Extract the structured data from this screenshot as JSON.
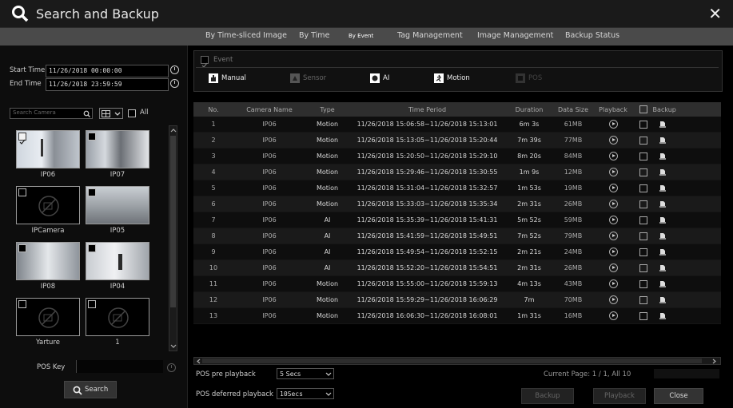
{
  "window": {
    "title": "Search and Backup",
    "close_label": "✕"
  },
  "tabs": [
    {
      "label": "By Time-sliced Image"
    },
    {
      "label": "By Time"
    },
    {
      "label": "By Event"
    },
    {
      "label": "Tag Management"
    },
    {
      "label": "Image Management"
    },
    {
      "label": "Backup Status"
    }
  ],
  "left": {
    "start_label": "Start Time",
    "start_value": "11/26/2018 00:00:00",
    "end_label": "End Time",
    "end_value": "11/26/2018 23:59:59",
    "search_placeholder": "Search Camera",
    "all_label": "All",
    "cameras": [
      {
        "name": "IP06",
        "checked": true,
        "has_image": true
      },
      {
        "name": "IP07",
        "checked": false,
        "has_image": true
      },
      {
        "name": "IPCamera",
        "checked": false,
        "has_image": false
      },
      {
        "name": "IP05",
        "checked": false,
        "has_image": true
      },
      {
        "name": "IP08",
        "checked": false,
        "has_image": true
      },
      {
        "name": "IP04",
        "checked": false,
        "has_image": true
      },
      {
        "name": "Yarture",
        "checked": false,
        "has_image": false
      },
      {
        "name": "1",
        "checked": false,
        "has_image": false
      }
    ],
    "pos_key_label": "POS Key",
    "search_button": "Search"
  },
  "event": {
    "header": "Event",
    "types": [
      {
        "label": "Manual",
        "enabled": true
      },
      {
        "label": "Sensor",
        "enabled": false
      },
      {
        "label": "AI",
        "enabled": true
      },
      {
        "label": "Motion",
        "enabled": true
      },
      {
        "label": "POS",
        "enabled": false
      }
    ]
  },
  "table": {
    "headers": [
      "No.",
      "Camera Name",
      "Type",
      "Time Period",
      "Duration",
      "Data Size",
      "Playback",
      "Backup"
    ],
    "rows": [
      {
        "no": "1",
        "camera": "IP06",
        "type": "Motion",
        "period": "11/26/2018 15:06:58~11/26/2018 15:13:01",
        "duration": "6m 3s",
        "size": "61MB"
      },
      {
        "no": "2",
        "camera": "IP06",
        "type": "Motion",
        "period": "11/26/2018 15:13:05~11/26/2018 15:20:44",
        "duration": "7m 39s",
        "size": "77MB"
      },
      {
        "no": "3",
        "camera": "IP06",
        "type": "Motion",
        "period": "11/26/2018 15:20:50~11/26/2018 15:29:10",
        "duration": "8m 20s",
        "size": "84MB"
      },
      {
        "no": "4",
        "camera": "IP06",
        "type": "Motion",
        "period": "11/26/2018 15:29:46~11/26/2018 15:30:55",
        "duration": "1m 9s",
        "size": "12MB"
      },
      {
        "no": "5",
        "camera": "IP06",
        "type": "Motion",
        "period": "11/26/2018 15:31:04~11/26/2018 15:32:57",
        "duration": "1m 53s",
        "size": "19MB"
      },
      {
        "no": "6",
        "camera": "IP06",
        "type": "Motion",
        "period": "11/26/2018 15:33:03~11/26/2018 15:35:34",
        "duration": "2m 31s",
        "size": "26MB"
      },
      {
        "no": "7",
        "camera": "IP06",
        "type": "AI",
        "period": "11/26/2018 15:35:39~11/26/2018 15:41:31",
        "duration": "5m 52s",
        "size": "59MB"
      },
      {
        "no": "8",
        "camera": "IP06",
        "type": "AI",
        "period": "11/26/2018 15:41:59~11/26/2018 15:49:51",
        "duration": "7m 52s",
        "size": "79MB"
      },
      {
        "no": "9",
        "camera": "IP06",
        "type": "AI",
        "period": "11/26/2018 15:49:54~11/26/2018 15:52:15",
        "duration": "2m 21s",
        "size": "24MB"
      },
      {
        "no": "10",
        "camera": "IP06",
        "type": "AI",
        "period": "11/26/2018 15:52:20~11/26/2018 15:54:51",
        "duration": "2m 31s",
        "size": "26MB"
      },
      {
        "no": "11",
        "camera": "IP06",
        "type": "Motion",
        "period": "11/26/2018 15:55:00~11/26/2018 15:59:13",
        "duration": "4m 13s",
        "size": "43MB"
      },
      {
        "no": "12",
        "camera": "IP06",
        "type": "Motion",
        "period": "11/26/2018 15:59:29~11/26/2018 16:06:29",
        "duration": "7m",
        "size": "70MB"
      },
      {
        "no": "13",
        "camera": "IP06",
        "type": "Motion",
        "period": "11/26/2018 16:06:30~11/26/2018 16:08:01",
        "duration": "1m 31s",
        "size": "16MB"
      }
    ]
  },
  "bottom": {
    "pre_label": "POS pre playback",
    "pre_value": "5 Secs",
    "post_label": "POS deferred playback",
    "post_value": "10Secs",
    "page_info": "Current Page: 1 / 1, All 10",
    "backup_button": "Backup",
    "playback_button": "Playback",
    "close_button": "Close"
  },
  "colors": {
    "accent": "#4a4a4a",
    "background": "#000000"
  }
}
